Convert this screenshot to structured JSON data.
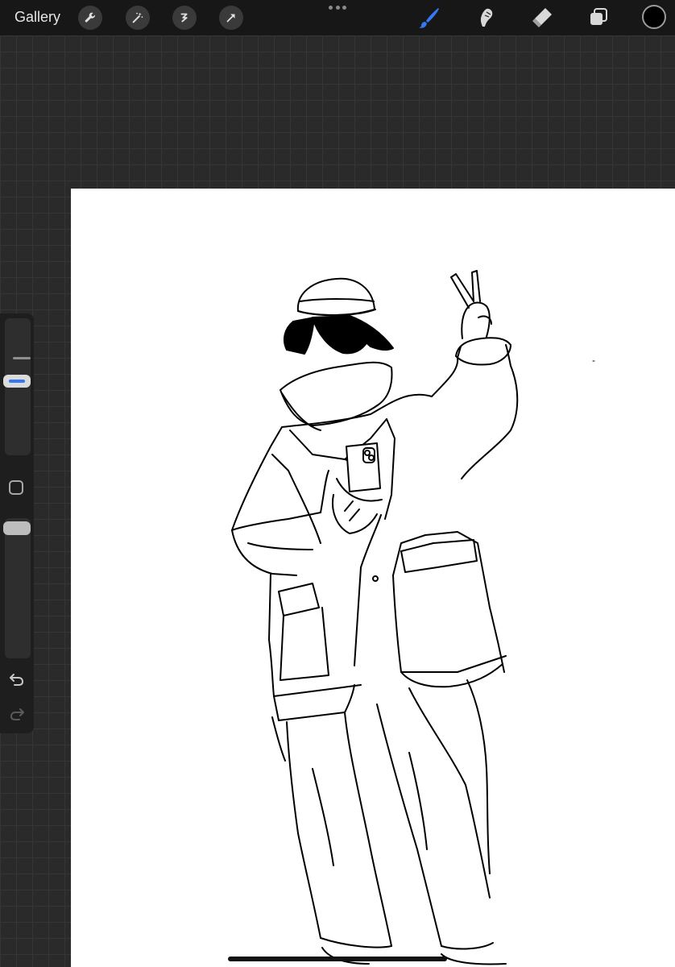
{
  "toolbar": {
    "gallery_label": "Gallery",
    "left_tools": [
      "wrench-icon",
      "magic-wand-icon",
      "selection-icon",
      "transform-arrow-icon"
    ],
    "right_tools": [
      "brush-icon",
      "smudge-icon",
      "eraser-icon",
      "layers-icon"
    ],
    "active_tool": "brush-icon",
    "active_color": "#3478f6",
    "current_color": "#000000"
  },
  "sidebar": {
    "brush_size_level": 0.55,
    "opacity_level": 1.0,
    "icons": [
      "modify-square-icon",
      "undo-icon",
      "redo-icon"
    ]
  },
  "canvas": {
    "background": "#ffffff",
    "content": "line-art-figure"
  }
}
